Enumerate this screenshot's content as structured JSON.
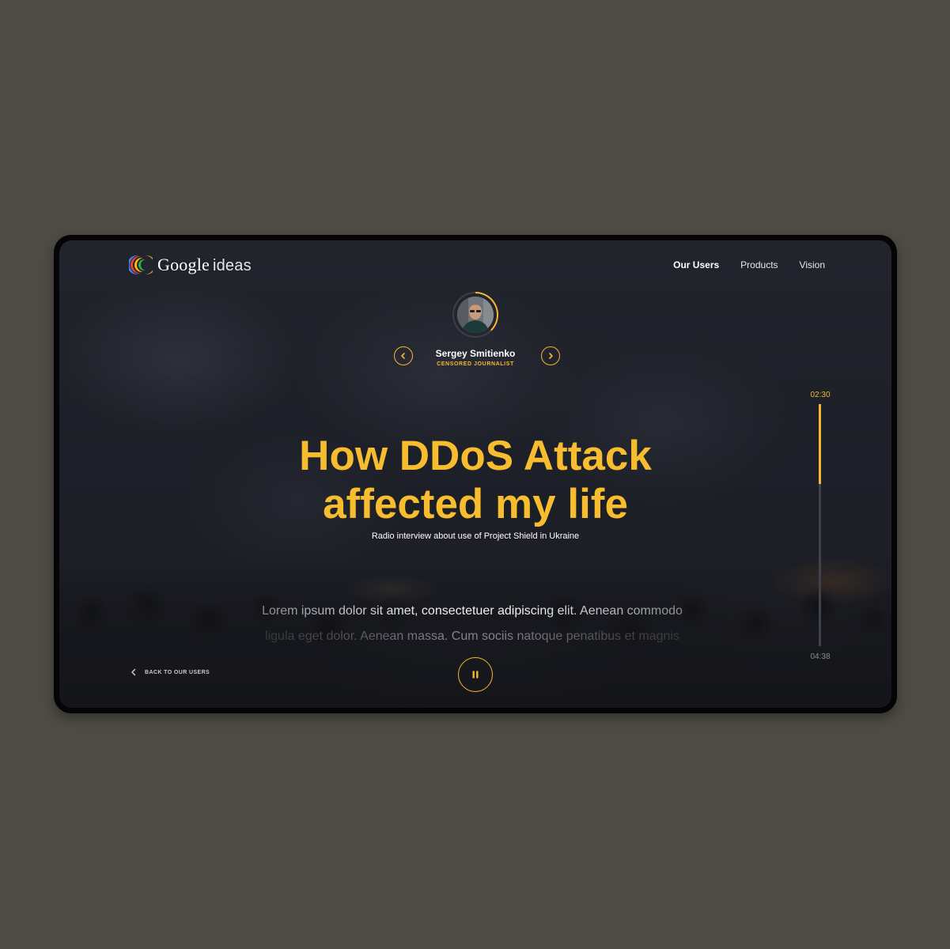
{
  "brand": {
    "name": "Google",
    "suffix": "ideas",
    "logo_icon": "google-ideas-logo"
  },
  "nav": {
    "items": [
      {
        "label": "Our Users",
        "active": true
      },
      {
        "label": "Products",
        "active": false
      },
      {
        "label": "Vision",
        "active": false
      }
    ]
  },
  "profile": {
    "name": "Sergey Smitienko",
    "role": "CENSORED JOURNALIST",
    "prev_icon": "chevron-left-icon",
    "next_icon": "chevron-right-icon",
    "avatar_icon": "avatar-photo"
  },
  "story": {
    "title_line1": "How DDoS Attack",
    "title_line2": "affected my life",
    "subtitle": "Radio interview about use of Project Shield in Ukraine"
  },
  "transcript": {
    "line1": "Lorem ipsum dolor sit amet, consectetuer adipiscing elit. Aenean commodo",
    "line2": "ligula eget dolor. Aenean massa. Cum sociis natoque penatibus et magnis"
  },
  "footer": {
    "back_label": "BACK TO OUR USERS",
    "back_icon": "chevron-left-icon"
  },
  "player": {
    "state_icon": "pause-icon",
    "current_time": "02:30",
    "total_time": "04:38",
    "progress": 0.33
  },
  "colors": {
    "accent": "#f4b92f",
    "background": "#4d4b44",
    "frame": "#050507"
  }
}
